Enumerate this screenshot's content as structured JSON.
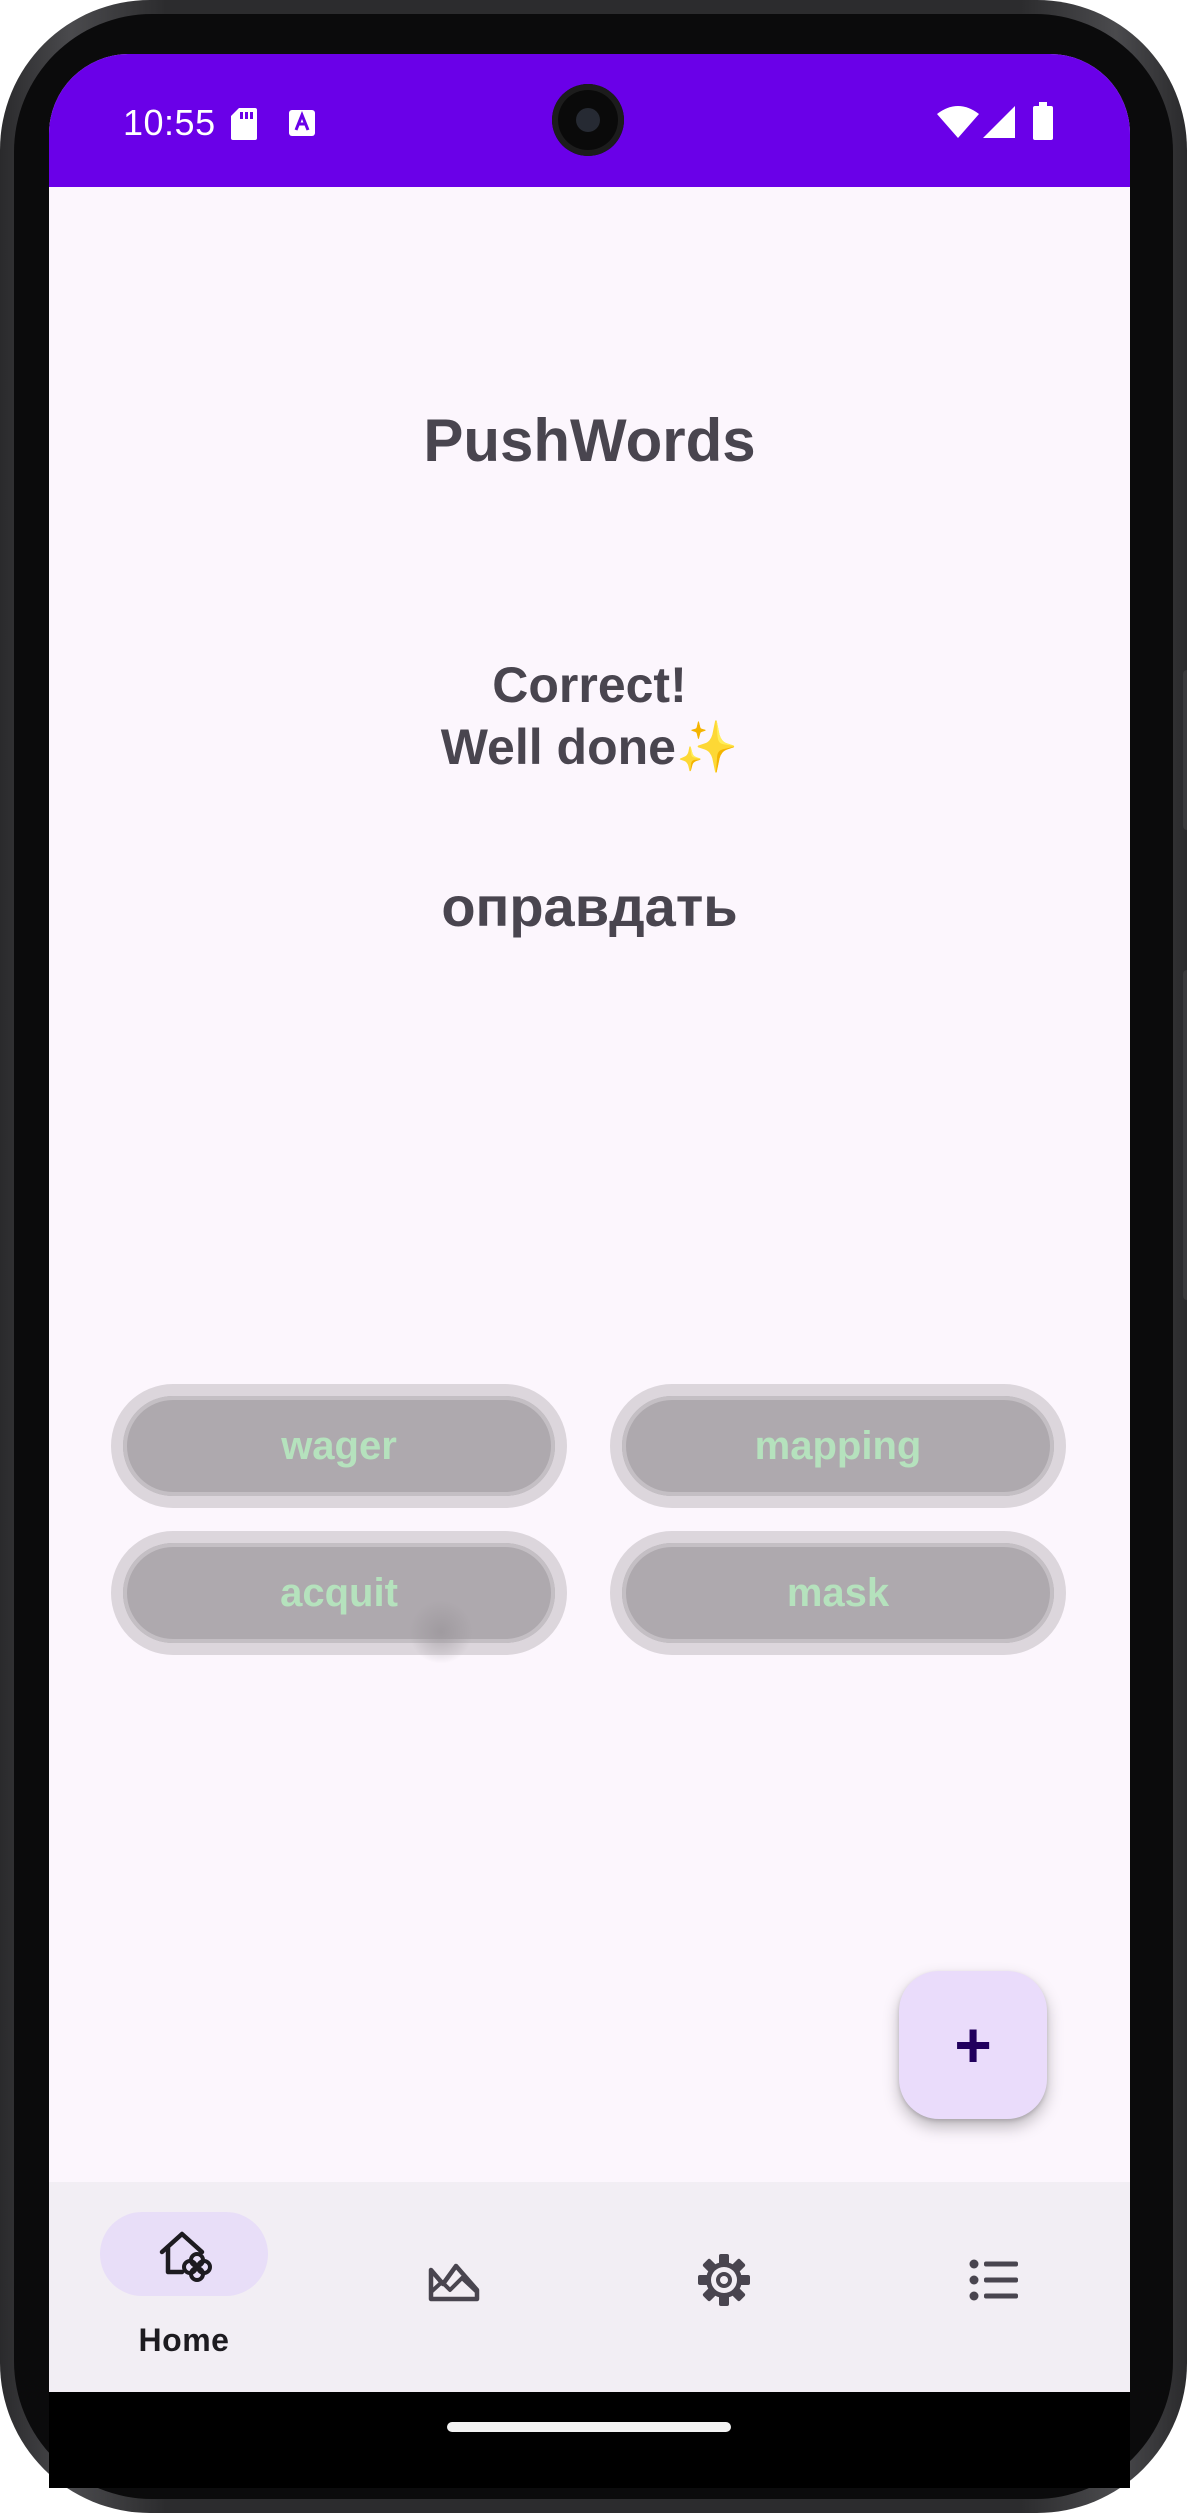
{
  "status_bar": {
    "time": "10:55",
    "left_icons": [
      "sd-card-icon",
      "text-a-icon"
    ],
    "right_icons": [
      "wifi-icon",
      "cellular-signal-icon",
      "battery-icon"
    ],
    "background_color": "#6a00e8"
  },
  "app": {
    "title": "PushWords"
  },
  "quiz": {
    "feedback_line1": "Correct!",
    "feedback_line2": "Well done✨",
    "word": "оправдать",
    "choices": [
      {
        "label": "wager"
      },
      {
        "label": "mapping"
      },
      {
        "label": "acquit"
      },
      {
        "label": "mask"
      }
    ],
    "choice_text_color": "#b5e2bd"
  },
  "fab": {
    "label": "+",
    "icon": "add-icon"
  },
  "bottom_nav": {
    "items": [
      {
        "label": "Home",
        "icon": "home-flower-icon",
        "selected": true
      },
      {
        "label": "",
        "icon": "landscape-image-icon",
        "selected": false
      },
      {
        "label": "",
        "icon": "gear-icon",
        "selected": false
      },
      {
        "label": "",
        "icon": "list-icon",
        "selected": false
      }
    ]
  },
  "colors": {
    "accent": "#6a00e8",
    "text_primary": "#49454f",
    "screen_background": "#fcf6fd",
    "nav_indicator": "#e8def8"
  }
}
